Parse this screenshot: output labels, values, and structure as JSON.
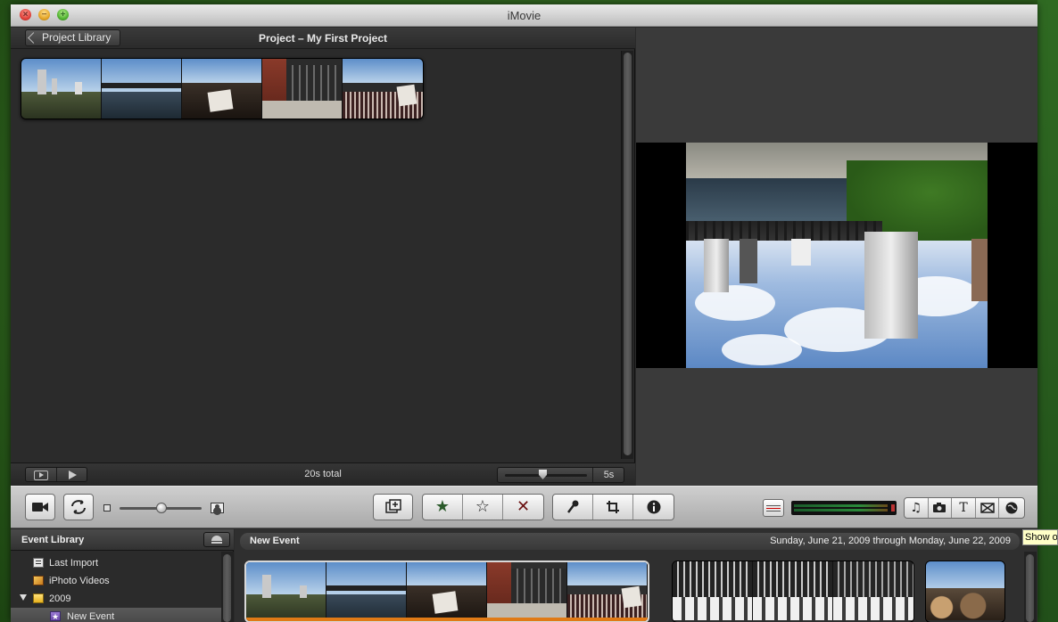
{
  "window": {
    "title": "iMovie"
  },
  "project": {
    "back_label": "Project Library",
    "title": "Project – My First Project",
    "total": "20s total",
    "thumb_duration": "5s"
  },
  "event_library": {
    "title": "Event Library",
    "items": [
      {
        "label": "Last Import",
        "icon": "last-import-icon"
      },
      {
        "label": "iPhoto Videos",
        "icon": "iphoto-icon"
      },
      {
        "label": "2009",
        "icon": "calendar-icon"
      },
      {
        "label": "New Event",
        "icon": "event-star-icon"
      }
    ]
  },
  "event_browser": {
    "name": "New Event",
    "date_range": "Sunday, June 21, 2009 through Monday, June 22, 2009"
  },
  "tooltip": {
    "text": "Show o"
  },
  "icons": {
    "star_filled": "★",
    "star_empty": "☆",
    "reject": "✕",
    "info": "ⓘ",
    "music": "♫",
    "text": "T"
  },
  "colors": {
    "accent_orange": "#e07a16",
    "selection_gray": "#5a5a5a"
  }
}
